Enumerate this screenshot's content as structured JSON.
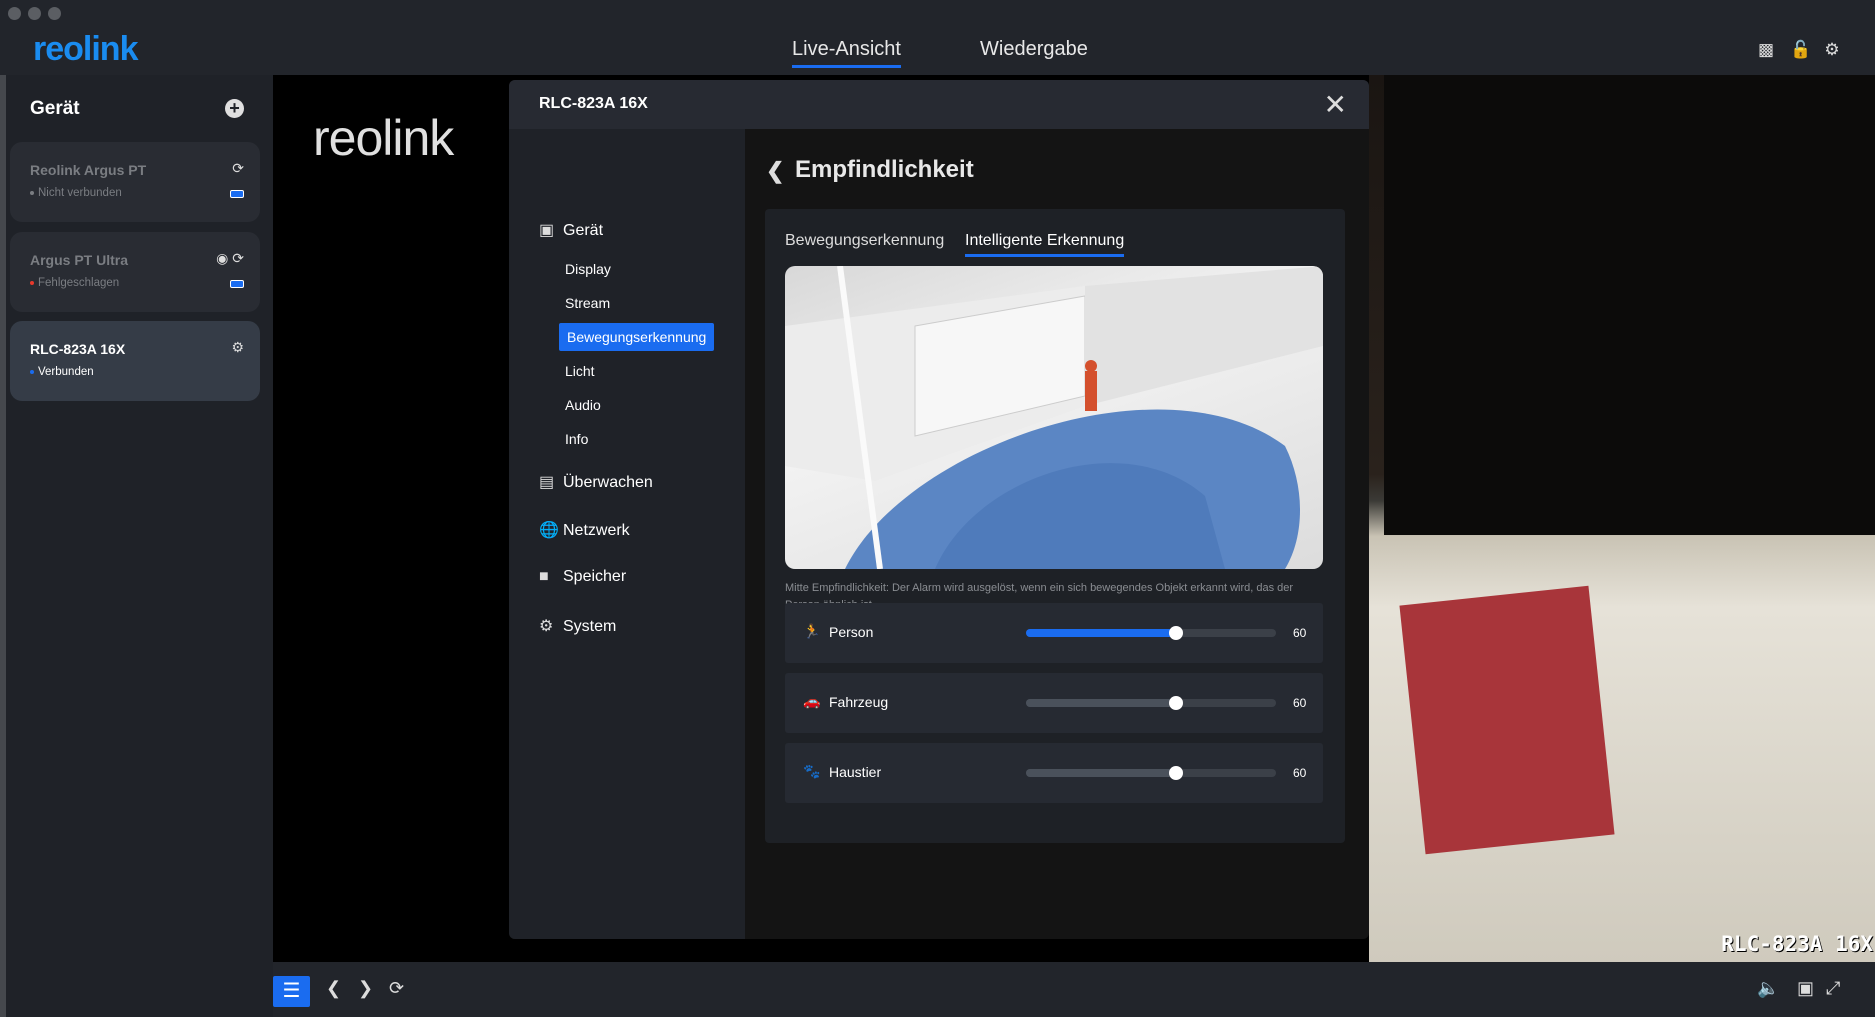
{
  "app": {
    "logo": "reolink",
    "tabs": [
      "Live-Ansicht",
      "Wiedergabe"
    ],
    "active_tab": "Live-Ansicht",
    "top_icons": [
      "chat-icon",
      "unlock-icon",
      "gear-icon"
    ]
  },
  "sidebar": {
    "title": "Gerät",
    "devices": [
      {
        "name": "Reolink Argus PT",
        "status": "Nicht verbunden",
        "status_color": "#7a7d82"
      },
      {
        "name": "Argus PT Ultra",
        "status": "Fehlgeschlagen",
        "status_color": "#e8392c"
      },
      {
        "name": "RLC-823A 16X",
        "status": "Verbunden",
        "status_color": "#1a6cf0"
      }
    ]
  },
  "video": {
    "watermark": "reolink",
    "osd": "RLC-823A 16X"
  },
  "modal": {
    "title": "RLC-823A 16X",
    "nav": {
      "geraet": "Gerät",
      "display": "Display",
      "stream": "Stream",
      "bewegung": "Bewegungserkennung",
      "licht": "Licht",
      "audio": "Audio",
      "info": "Info",
      "ueberwachen": "Überwachen",
      "netzwerk": "Netzwerk",
      "speicher": "Speicher",
      "system": "System"
    },
    "page_title": "Empfindlichkeit",
    "tabs": [
      "Bewegungserkennung",
      "Intelligente Erkennung"
    ],
    "active_tab": "Intelligente Erkennung",
    "description": "Mitte Empfindlichkeit: Der Alarm wird ausgelöst, wenn ein sich bewegendes Objekt erkannt wird, das der Person ähnlich ist.",
    "sliders": [
      {
        "label": "Person",
        "value": "60",
        "percent": 60
      },
      {
        "label": "Fahrzeug",
        "value": "60",
        "percent": 60
      },
      {
        "label": "Haustier",
        "value": "60",
        "percent": 60
      }
    ]
  },
  "accent": "#1a6cf0"
}
